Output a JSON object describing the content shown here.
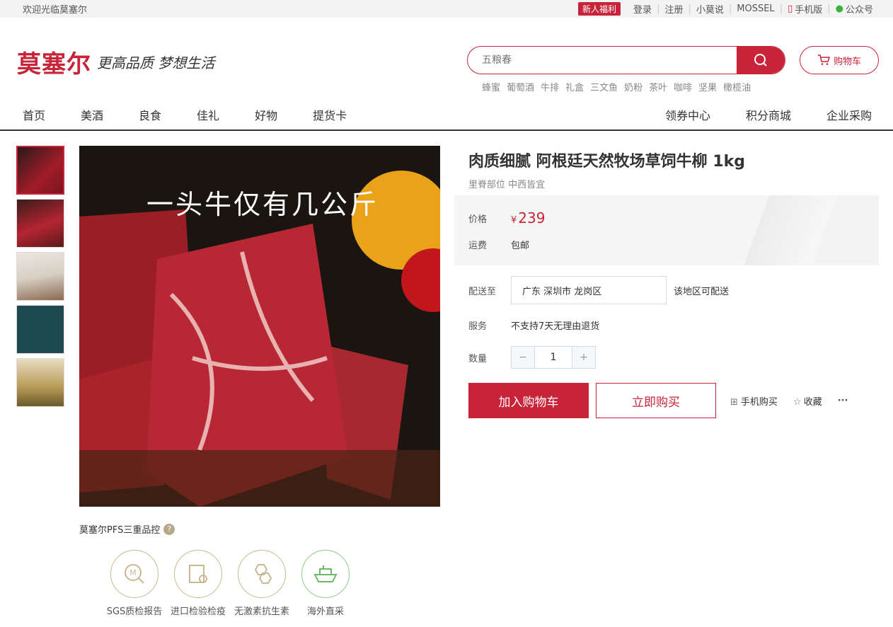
{
  "topbar": {
    "welcome": "欢迎光临莫塞尔",
    "promo_badge": "新人福利",
    "links": [
      "登录",
      "注册",
      "小莫说",
      "MOSSEL"
    ],
    "mobile": "手机版",
    "wechat": "公众号"
  },
  "header": {
    "logo": "莫塞尔",
    "slogan": "更高品质 梦想生活",
    "search_placeholder": "五粮春",
    "cart_label": "购物车",
    "hotwords": [
      "蜂蜜",
      "葡萄酒",
      "牛排",
      "礼盒",
      "三文鱼",
      "奶粉",
      "茶叶",
      "咖啡",
      "坚果",
      "橄榄油"
    ]
  },
  "nav": {
    "left": [
      "首页",
      "美酒",
      "良食",
      "佳礼",
      "好物",
      "提货卡"
    ],
    "right": [
      "领券中心",
      "积分商城",
      "企业采购"
    ]
  },
  "gallery": {
    "caption": "一头牛仅有几公斤",
    "thumb_count": 5
  },
  "pfs": {
    "title": "莫塞尔PFS三重品控",
    "help": "?",
    "items": [
      "SGS质检报告",
      "进口检验检疫",
      "无激素抗生素",
      "海外直采"
    ]
  },
  "product": {
    "title": "肉质细腻 阿根廷天然牧场草饲牛柳 1kg",
    "subtitle": "里脊部位 中西皆宜",
    "price_label": "价格",
    "currency": "¥",
    "price": "239",
    "shipping_label": "运费",
    "shipping": "包邮",
    "deliver_label": "配送至",
    "address": "广东 深圳市 龙岗区",
    "deliver_status": "该地区可配送",
    "service_label": "服务",
    "service": "不支持7天无理由退货",
    "qty_label": "数量",
    "qty": "1",
    "minus": "−",
    "plus": "+",
    "add_cart": "加入购物车",
    "buy_now": "立即购买",
    "mobile_buy": "手机购买",
    "favorite": "收藏",
    "more": "···"
  },
  "colors": {
    "brand": "#c7243a"
  }
}
